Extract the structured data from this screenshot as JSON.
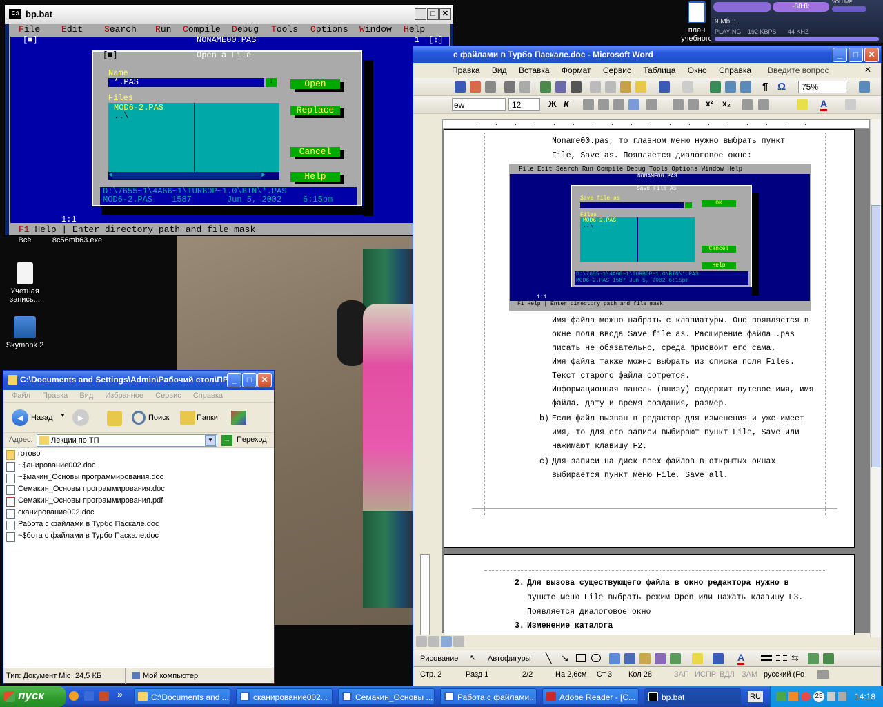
{
  "desktop": {
    "icons": [
      {
        "label": "Учетная запись...",
        "name": "account-icon"
      },
      {
        "label": "Skymonk 2",
        "name": "skymonk-icon"
      },
      {
        "label": "Всё",
        "name": "all-icon"
      },
      {
        "label": "8c56mb63.exe",
        "name": "exe-icon"
      },
      {
        "label": "план учебного",
        "name": "plan-doc-icon"
      }
    ]
  },
  "dos": {
    "title": "bp.bat",
    "menu": [
      {
        "hk": "F",
        "rest": "ile"
      },
      {
        "hk": "E",
        "rest": "dit"
      },
      {
        "hk": "S",
        "rest": "earch"
      },
      {
        "hk": "R",
        "rest": "un"
      },
      {
        "hk": "C",
        "rest": "ompile"
      },
      {
        "hk": "D",
        "rest": "ebug"
      },
      {
        "hk": "T",
        "rest": "ools"
      },
      {
        "hk": "O",
        "rest": "ptions"
      },
      {
        "hk": "W",
        "rest": "indow"
      },
      {
        "hk": "H",
        "rest": "elp"
      }
    ],
    "editor_title": "NONAME00.PAS",
    "editor_num": "1",
    "position": "1:1",
    "dialog": {
      "title": "Open a File",
      "name_label": "Name",
      "name_value": "*.PAS",
      "files_label": "Files",
      "files": [
        "MOD6-2.PAS",
        "..\\"
      ],
      "btn_open": "Open",
      "btn_replace": "Replace",
      "btn_cancel": "Cancel",
      "btn_help": "Help",
      "path": "D:\\7655~1\\4A66~1\\TURBOP~1.0\\BIN\\*.PAS",
      "info_file": "MOD6-2.PAS",
      "info_size": "1587",
      "info_date": "Jun  5, 2002",
      "info_time": "6:15pm"
    },
    "status_key": "F1",
    "status_text": "Help | Enter directory path and file mask"
  },
  "explorer": {
    "title": "C:\\Documents and Settings\\Admin\\Рабочий стол\\ПРИ...",
    "menu": [
      "Файл",
      "Правка",
      "Вид",
      "Избранное",
      "Сервис",
      "Справка"
    ],
    "back": "Назад",
    "search": "Поиск",
    "folders": "Папки",
    "address_label": "Адрес:",
    "address_value": "Лекции по ТП",
    "go": "Переход",
    "files": [
      {
        "name": "готово",
        "type": "folder"
      },
      {
        "name": "~$анирование002.doc",
        "type": "doc"
      },
      {
        "name": "~$макин_Основы программирования.doc",
        "type": "doc"
      },
      {
        "name": "Семакин_Основы программирования.doc",
        "type": "doc"
      },
      {
        "name": "Семакин_Основы программирования.pdf",
        "type": "pdf"
      },
      {
        "name": "сканирование002.doc",
        "type": "doc"
      },
      {
        "name": "Работа с файлами в Турбо Паскале.doc",
        "type": "doc"
      },
      {
        "name": "~$бота с файлами в Турбо Паскале.doc",
        "type": "doc"
      }
    ],
    "status_type": "Тип: Документ Mic",
    "status_size": "24,5 КБ",
    "status_location": "Мой компьютер"
  },
  "word": {
    "title": "с файлами в Турбо Паскале.doc - Microsoft Word",
    "menu": [
      "Правка",
      "Вид",
      "Вставка",
      "Формат",
      "Сервис",
      "Таблица",
      "Окно",
      "Справка"
    ],
    "help_placeholder": "Введите вопрос",
    "zoom": "75%",
    "font_name": "ew",
    "font_size": "12",
    "page1_lines": [
      "Noname00.pas,  то  главном  меню  нужно  выбрать  пункт",
      "File, Save as. Появляется диалоговое окно:"
    ],
    "embed": {
      "menu": "File  Edit  Search  Run  Compile  Debug  Tools  Options  Window  Help",
      "editor_title": "NONAME00.PAS",
      "dialog_title": "Save File As",
      "label": "Save file as",
      "btn_ok": "OK",
      "files_label": "Files",
      "files": [
        "MOD6-2.PAS",
        "..\\"
      ],
      "btn_cancel": "Cancel",
      "btn_help": "Help",
      "path": "D:\\7655~1\\4A66~1\\TURBOP~1.0\\BIN\\*.PAS",
      "info": "MOD6-2.PAS    1587      Jun  5, 2002    6:15pm",
      "status": "F1 Help | Enter directory path and file mask",
      "position": "1:1"
    },
    "page1_after": [
      "Имя файла можно набрать с клавиатуры. Оно появляется в",
      "окне поля ввода Save file as. Расширение  файла  .pas",
      "писать не обязательно, среда присвоит его сама.",
      "Имя файла также можно выбрать из списка поля Files.",
      "Текст старого файла сотрется.",
      "Информационная панель (внизу) содержит путевое имя, имя",
      "файла, дату и время создания, размер."
    ],
    "item_b_marker": "b)",
    "item_b": [
      "Если файл вызван в редактор для изменения и уже имеет",
      "имя, то для его записи выбирают пункт File, Save или",
      "нажимают клавишу F2."
    ],
    "item_c_marker": "c)",
    "item_c": [
      "Для  записи  на  диск  всех  файлов  в  открытых  окнах",
      "выбирается пункт меню File, Save all."
    ],
    "page2_lines": [
      {
        "marker": "2.",
        "text": "Для  вызова  существующего  файла  в  окно  редактора  нужно  в"
      },
      {
        "marker": "",
        "text": "пункте меню File выбрать режим Open или нажать клавишу F3."
      },
      {
        "marker": "",
        "text": "Появляется диалоговое окно"
      },
      {
        "marker": "3.",
        "text": "Изменение каталога"
      }
    ],
    "draw_label": "Рисование",
    "autoshapes": "Автофигуры",
    "status": {
      "page": "Стр. 2",
      "section": "Разд 1",
      "pages": "2/2",
      "at": "На 2,6см",
      "line": "Ст 3",
      "col": "Кол 28",
      "rec": "ЗАП",
      "trk": "ИСПР",
      "ext": "ВДЛ",
      "ovr": "ЗАМ",
      "lang": "русский (Ро"
    }
  },
  "media": {
    "time": "-88:8:",
    "label_volume": "VOLUME",
    "size": "9 Mb ::.",
    "playing": "PLAYING",
    "kbps": "192 KBPS",
    "khz": "44 KHZ"
  },
  "taskbar": {
    "start": "пуск",
    "buttons": [
      {
        "label": "C:\\Documents and ...",
        "name": "task-explorer"
      },
      {
        "label": "сканирование002...",
        "name": "task-scan-doc"
      },
      {
        "label": "Семакин_Основы ...",
        "name": "task-semakin-doc"
      },
      {
        "label": "Работа с файлами...",
        "name": "task-work-doc"
      },
      {
        "label": "Adobe Reader - [C...",
        "name": "task-adobe"
      },
      {
        "label": "bp.bat",
        "name": "task-bp-bat"
      }
    ],
    "lang": "RU",
    "tray_badge": "25",
    "clock": "14:18"
  }
}
